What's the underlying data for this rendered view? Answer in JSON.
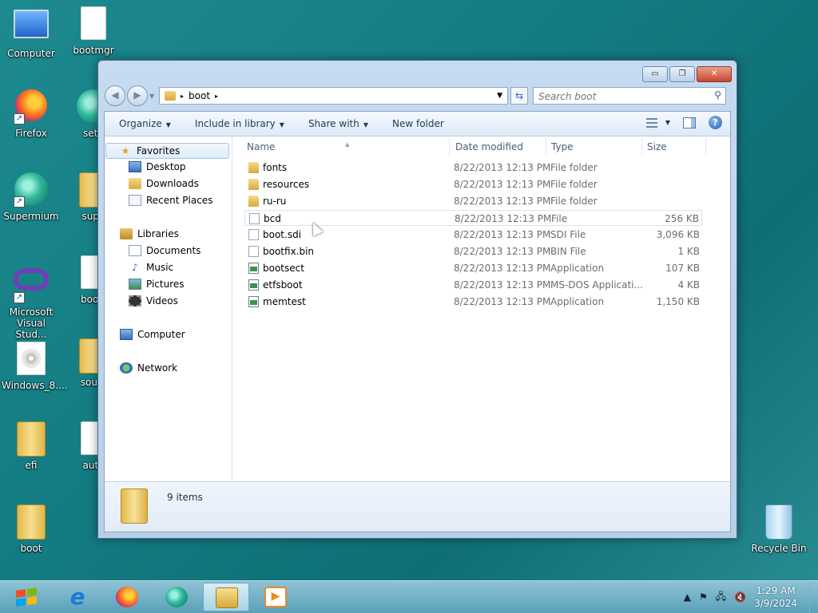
{
  "desktop": {
    "icons": [
      {
        "label": "Computer"
      },
      {
        "label": "bootmgr"
      },
      {
        "label": "Firefox"
      },
      {
        "label": "setu"
      },
      {
        "label": "Supermium"
      },
      {
        "label": "supp"
      },
      {
        "label": "Microsoft Visual Stud..."
      },
      {
        "label": "bootr"
      },
      {
        "label": "Windows_8...."
      },
      {
        "label": "sourc"
      },
      {
        "label": "efi"
      },
      {
        "label": "auto"
      },
      {
        "label": "boot"
      },
      {
        "label": "Recycle Bin"
      }
    ]
  },
  "window": {
    "buttons": {
      "minimize": "▭",
      "restore": "❐",
      "close": "✕"
    },
    "address": {
      "crumb": "boot",
      "arrow": "▸"
    },
    "search": {
      "placeholder": "Search boot"
    },
    "toolbar": {
      "organize": "Organize",
      "include": "Include in library",
      "share": "Share with",
      "new_folder": "New folder"
    },
    "nav": {
      "favorites": "Favorites",
      "desktop": "Desktop",
      "downloads": "Downloads",
      "recent": "Recent Places",
      "libraries": "Libraries",
      "documents": "Documents",
      "music": "Music",
      "pictures": "Pictures",
      "videos": "Videos",
      "computer": "Computer",
      "network": "Network"
    },
    "columns": {
      "name": "Name",
      "date": "Date modified",
      "type": "Type",
      "size": "Size"
    },
    "files": [
      {
        "name": "fonts",
        "date": "8/22/2013 12:13 PM",
        "type": "File folder",
        "size": "",
        "icon": "folder-icon"
      },
      {
        "name": "resources",
        "date": "8/22/2013 12:13 PM",
        "type": "File folder",
        "size": "",
        "icon": "folder-icon"
      },
      {
        "name": "ru-ru",
        "date": "8/22/2013 12:13 PM",
        "type": "File folder",
        "size": "",
        "icon": "folder-icon"
      },
      {
        "name": "bcd",
        "date": "8/22/2013 12:13 PM",
        "type": "File",
        "size": "256 KB",
        "icon": "file-icon"
      },
      {
        "name": "boot.sdi",
        "date": "8/22/2013 12:13 PM",
        "type": "SDI File",
        "size": "3,096 KB",
        "icon": "file-icon"
      },
      {
        "name": "bootfix.bin",
        "date": "8/22/2013 12:13 PM",
        "type": "BIN File",
        "size": "1 KB",
        "icon": "file-icon"
      },
      {
        "name": "bootsect",
        "date": "8/22/2013 12:13 PM",
        "type": "Application",
        "size": "107 KB",
        "icon": "app-icon"
      },
      {
        "name": "etfsboot",
        "date": "8/22/2013 12:13 PM",
        "type": "MS-DOS Applicati...",
        "size": "4 KB",
        "icon": "app-icon"
      },
      {
        "name": "memtest",
        "date": "8/22/2013 12:13 PM",
        "type": "Application",
        "size": "1,150 KB",
        "icon": "app-icon"
      }
    ],
    "status": {
      "count": "9 items"
    }
  },
  "taskbar": {
    "clock": {
      "time": "1:29 AM",
      "date": "3/9/2024"
    },
    "tray_arrow": "▲"
  }
}
